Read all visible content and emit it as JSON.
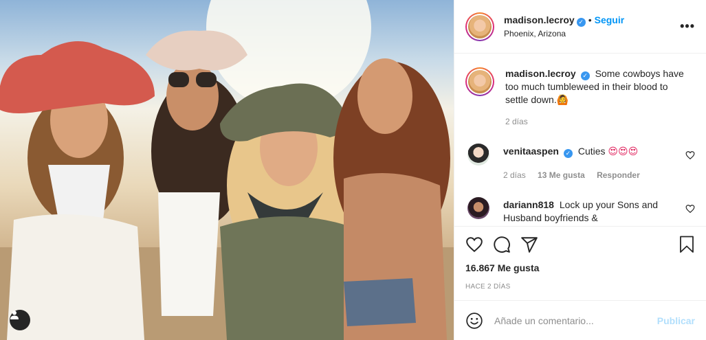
{
  "post": {
    "username": "madison.lecroy",
    "follow_label": "Seguir",
    "location": "Phoenix, Arizona",
    "more_label": "•••",
    "photo_alt": "",
    "caption": {
      "username": "madison.lecroy",
      "text": "Some cowboys have too much tumbleweed in their blood to settle down.",
      "emoji": "🙆",
      "time": "2 días"
    },
    "comments": [
      {
        "username": "venitaaspen",
        "text": "Cuties",
        "emoji": "😍😍😍",
        "time": "2 días",
        "likes": "13 Me gusta",
        "reply": "Responder"
      },
      {
        "username": "dariann818",
        "text": "Lock up your Sons and Husband boyfriends &"
      }
    ],
    "likes_count": "16.867 Me gusta",
    "posted_ago": "HACE 2 DÍAS",
    "add_comment_placeholder": "Añade un comentario...",
    "publish_label": "Publicar"
  },
  "colors": {
    "link_blue": "#0095f6",
    "verified_blue": "#3897f0",
    "muted": "#8e8e8e",
    "publish_disabled": "#b2dffc"
  }
}
